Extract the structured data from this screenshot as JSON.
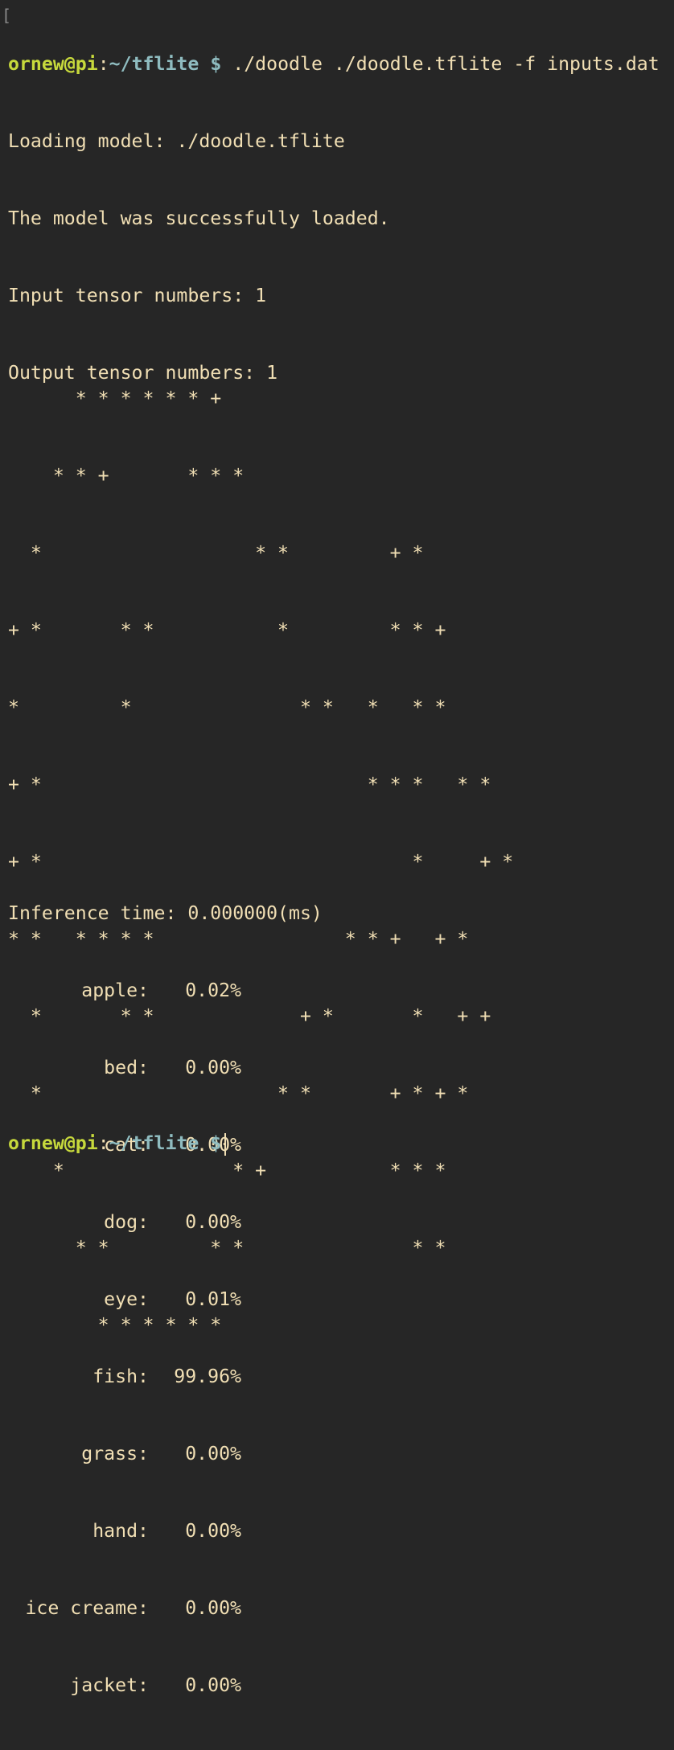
{
  "prompt": {
    "user_host": "ornew@pi",
    "colon": ":",
    "path": "~/tflite",
    "dollar": "$"
  },
  "command": "./doodle ./doodle.tflite -f inputs.dat",
  "output": [
    "Loading model: ./doodle.tflite",
    "The model was successfully loaded.",
    "Input tensor numbers: 1",
    "Output tensor numbers: 1"
  ],
  "doodle_art": [
    "      * * * * * * +",
    "    * * +       * * *",
    "  *                   * *         + *",
    "+ *       * *           *         * * +",
    "*         *               * *   *   * *",
    "+ *                             * * *   * *",
    "+ *                                 *     + *",
    "* *   * * * *                 * * +   + *",
    "  *       * *             + *       *   + +",
    "  *                     * *       + * + *",
    "    *               * +           * * *",
    "      * *         * *               * *",
    "        * * * * * *"
  ],
  "inference_time": "Inference time: 0.000000(ms)",
  "results": [
    {
      "label": "apple:",
      "value": "0.02%"
    },
    {
      "label": "bed:",
      "value": "0.00%"
    },
    {
      "label": "cat:",
      "value": "0.00%"
    },
    {
      "label": "dog:",
      "value": "0.00%"
    },
    {
      "label": "eye:",
      "value": "0.01%"
    },
    {
      "label": "fish:",
      "value": "99.96%"
    },
    {
      "label": "grass:",
      "value": "0.00%"
    },
    {
      "label": "hand:",
      "value": "0.00%"
    },
    {
      "label": "ice creame:",
      "value": "0.00%"
    },
    {
      "label": "jacket:",
      "value": "0.00%"
    }
  ]
}
